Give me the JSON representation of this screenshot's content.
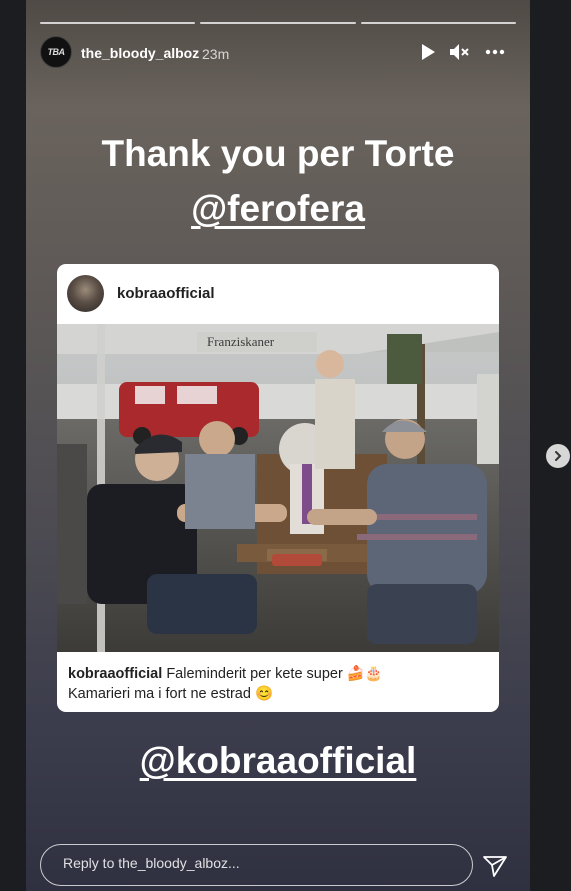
{
  "story": {
    "segments": 3,
    "user": {
      "avatar_text": "TBA",
      "username": "the_bloody_alboz",
      "time": "23m"
    },
    "controls": {
      "play_icon": "play-icon",
      "mute_icon": "muted-speaker-icon",
      "more_icon": "more-horizontal-icon"
    },
    "text_line1": "Thank you per Torte",
    "text_line2": "@ferofera",
    "embedded_post": {
      "username": "kobraaofficial",
      "caption_user": "kobraaofficial",
      "caption_text": "Faleminderit per kete super 🍰🎂",
      "caption_line2": "Kamarieri ma i fort ne estrad 😊",
      "photo_sign": "Franziskaner"
    },
    "mention": "@kobraaofficial",
    "reply": {
      "placeholder": "Reply to the_bloody_alboz..."
    },
    "send_icon": "send-icon"
  },
  "navigation": {
    "next_icon": "chevron-right-icon"
  }
}
